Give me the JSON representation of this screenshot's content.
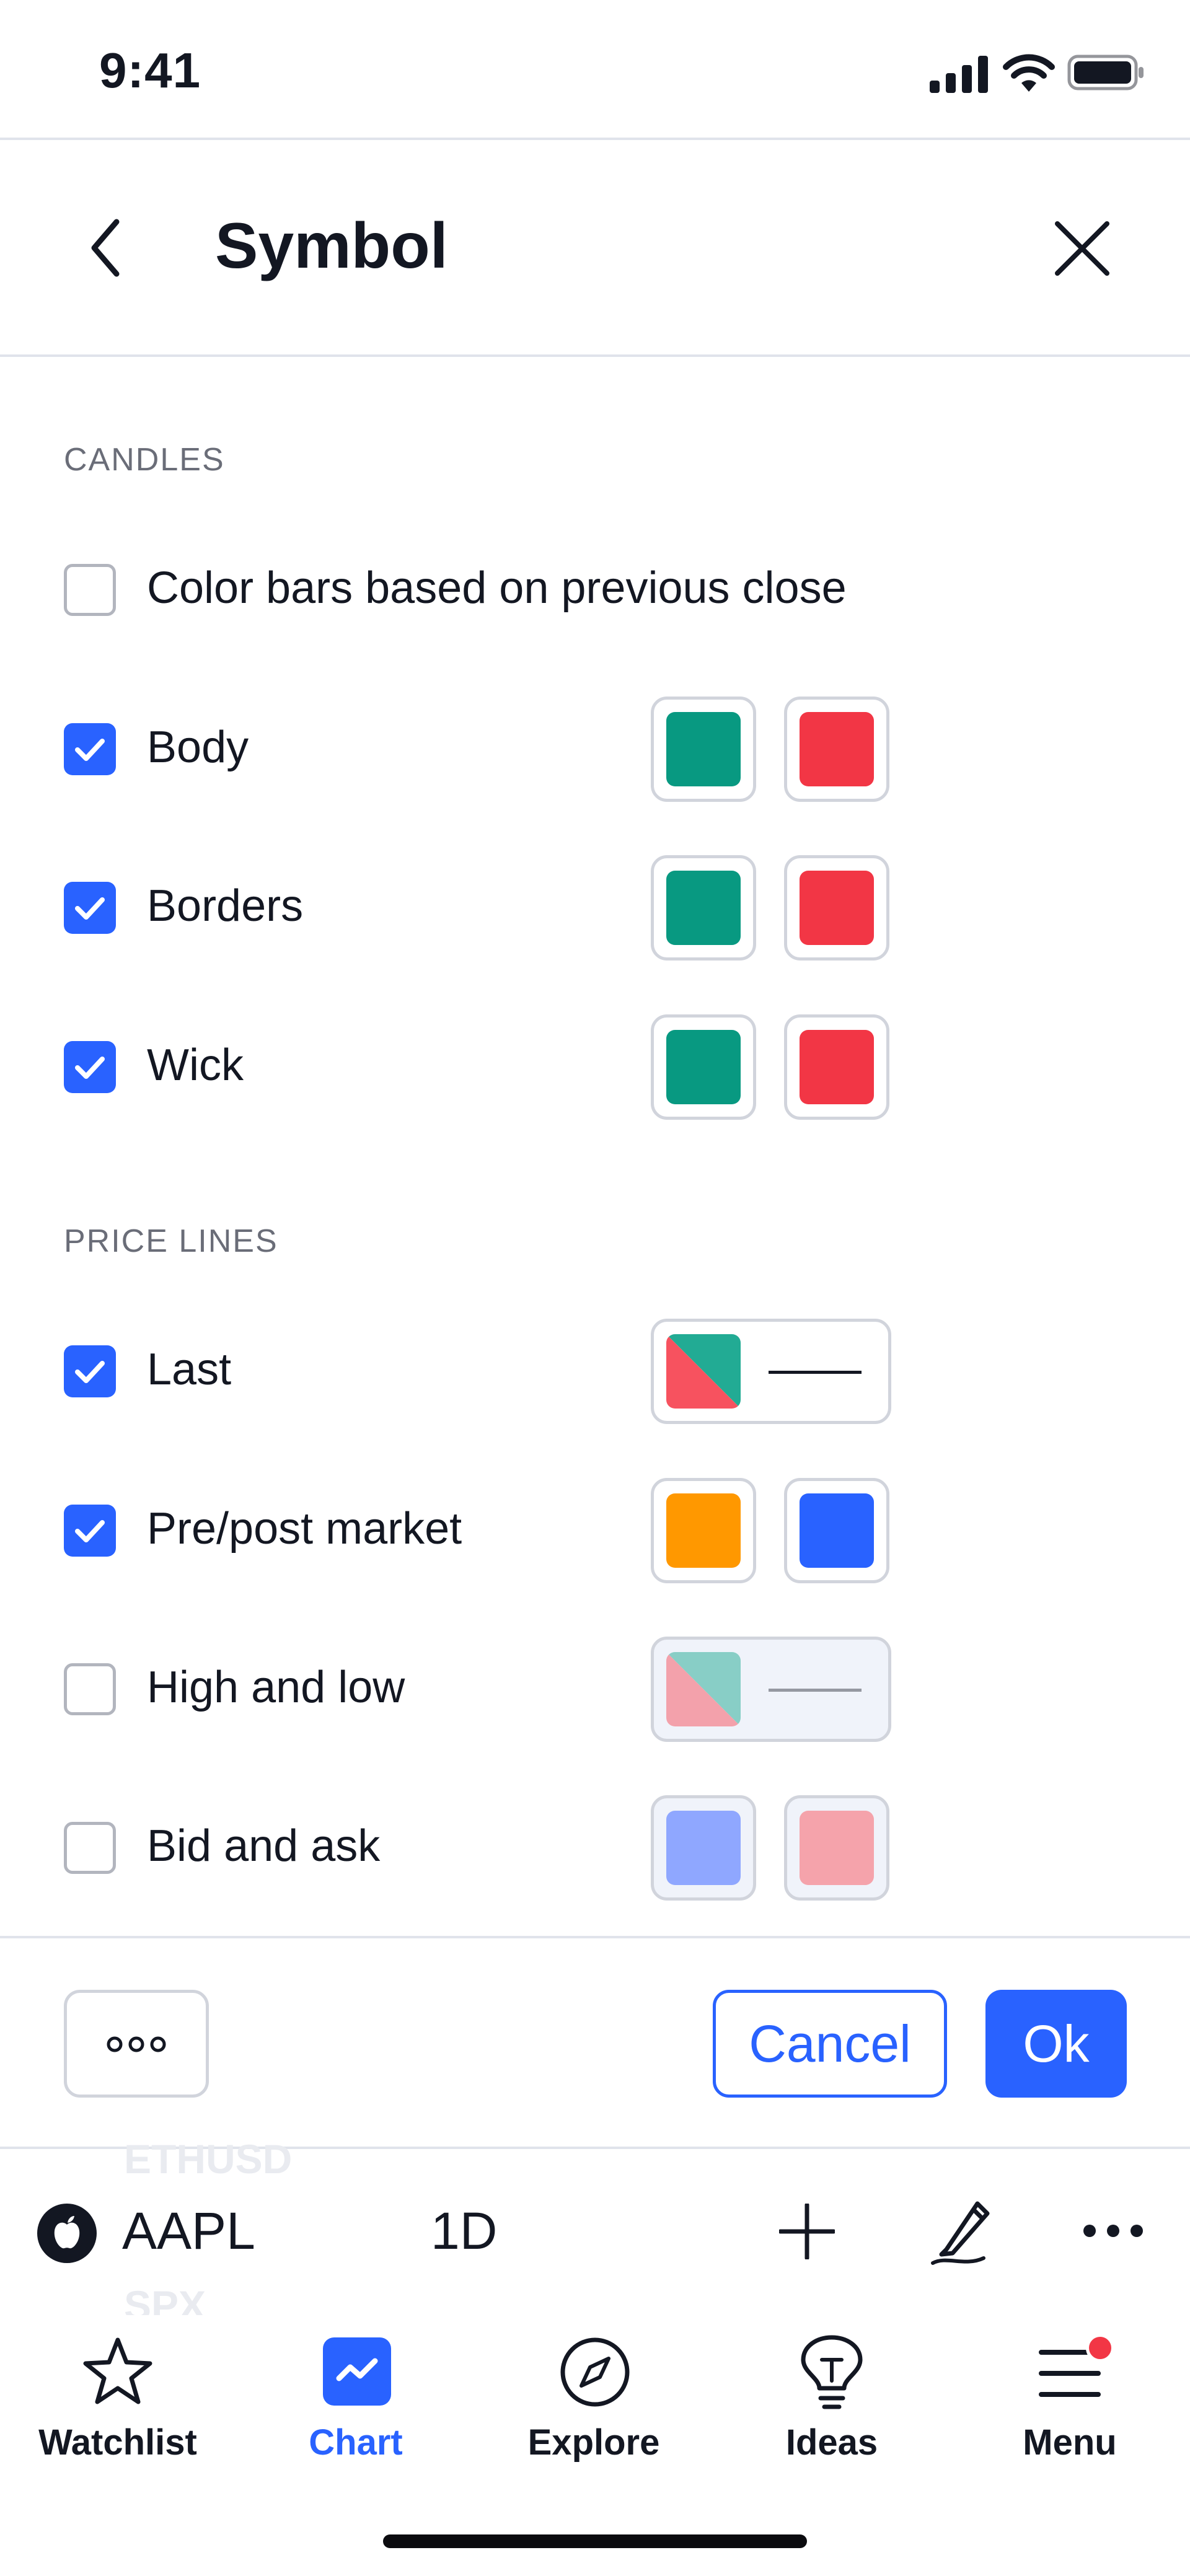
{
  "status_bar": {
    "time": "9:41"
  },
  "header": {
    "title": "Symbol"
  },
  "colors": {
    "accent": "#2962ff",
    "up": "#089981",
    "down": "#f23645",
    "premarket": "#ff9800",
    "postmarket": "#2962ff"
  },
  "candles": {
    "section_label": "CANDLES",
    "rows": [
      {
        "label": "Color bars based on previous close",
        "checked": false
      },
      {
        "label": "Body",
        "checked": true,
        "colors": [
          "#089981",
          "#f23645"
        ]
      },
      {
        "label": "Borders",
        "checked": true,
        "colors": [
          "#089981",
          "#f23645"
        ]
      },
      {
        "label": "Wick",
        "checked": true,
        "colors": [
          "#089981",
          "#f23645"
        ]
      }
    ]
  },
  "price_lines": {
    "section_label": "PRICE LINES",
    "rows": [
      {
        "label": "Last",
        "checked": true,
        "style": "solid-line"
      },
      {
        "label": "Pre/post market",
        "checked": true,
        "colors": [
          "#ff9800",
          "#2962ff"
        ]
      },
      {
        "label": "High and low",
        "checked": false,
        "style": "solid-line"
      },
      {
        "label": "Bid and ask",
        "checked": false,
        "colors": [
          "#8fa7ff",
          "#f5a3ab"
        ]
      }
    ]
  },
  "footer": {
    "cancel_label": "Cancel",
    "ok_label": "Ok"
  },
  "chart_toolbar": {
    "symbol": "AAPL",
    "interval": "1D",
    "ghost_above": "ETHUSD",
    "ghost_below": "SPX"
  },
  "tabs": [
    {
      "label": "Watchlist",
      "icon": "star-icon",
      "active": false
    },
    {
      "label": "Chart",
      "icon": "chart-icon",
      "active": true
    },
    {
      "label": "Explore",
      "icon": "compass-icon",
      "active": false
    },
    {
      "label": "Ideas",
      "icon": "lightbulb-icon",
      "active": false
    },
    {
      "label": "Menu",
      "icon": "menu-icon",
      "active": false,
      "badge": true
    }
  ]
}
